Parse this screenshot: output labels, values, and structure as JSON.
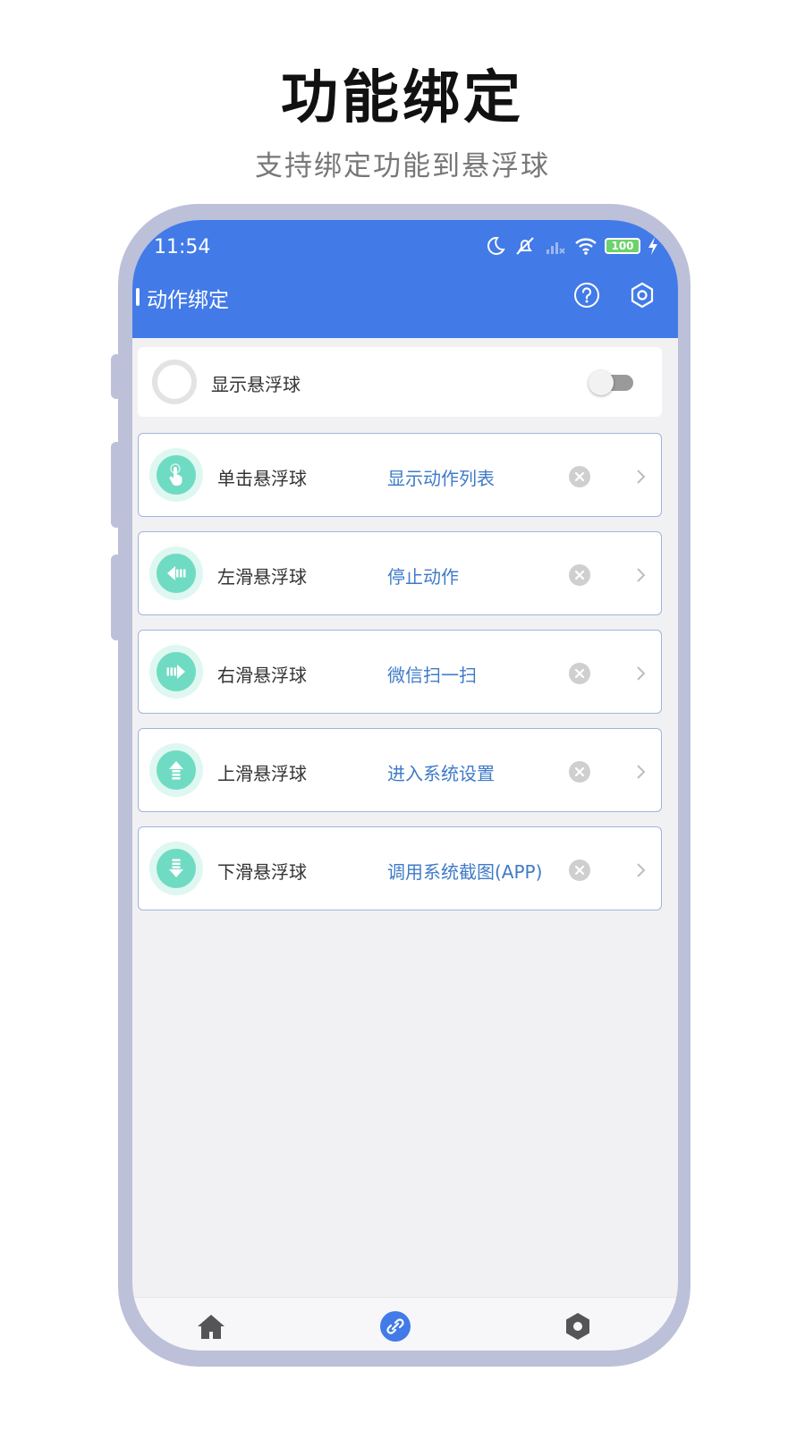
{
  "promo": {
    "title": "功能绑定",
    "subtitle": "支持绑定功能到悬浮球"
  },
  "status_bar": {
    "time": "11:54",
    "battery": "100",
    "icons": [
      "moon-icon",
      "mute-icon",
      "signal-icon",
      "wifi-icon",
      "battery-icon",
      "charging-icon"
    ]
  },
  "app_bar": {
    "title": "动作绑定",
    "actions": [
      "help-icon",
      "settings-icon"
    ]
  },
  "float_ball": {
    "label": "显示悬浮球",
    "enabled": false
  },
  "bindings": [
    {
      "gesture": "单击悬浮球",
      "action": "显示动作列表",
      "icon": "tap-icon"
    },
    {
      "gesture": "左滑悬浮球",
      "action": "停止动作",
      "icon": "arrow-left-icon"
    },
    {
      "gesture": "右滑悬浮球",
      "action": "微信扫一扫",
      "icon": "arrow-right-icon"
    },
    {
      "gesture": "上滑悬浮球",
      "action": "进入系统设置",
      "icon": "arrow-up-icon"
    },
    {
      "gesture": "下滑悬浮球",
      "action": "调用系统截图(APP)",
      "icon": "arrow-down-icon"
    }
  ],
  "tab_bar": {
    "tabs": [
      "home-icon",
      "link-icon",
      "settings-icon"
    ],
    "active_index": 1
  },
  "colors": {
    "header": "#427ae8",
    "accent_teal": "#6fdbc2",
    "action_text": "#3f7bc8",
    "frame": "#bcc0d8"
  }
}
